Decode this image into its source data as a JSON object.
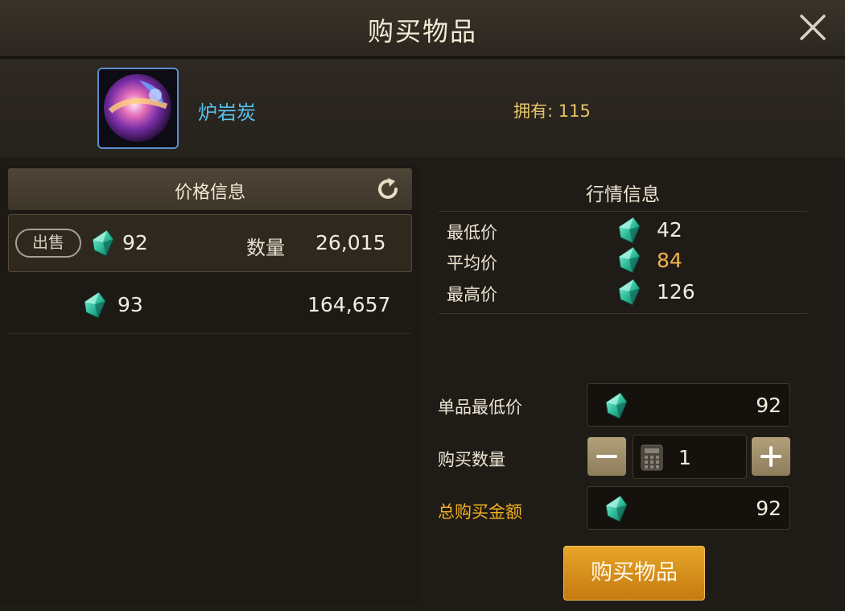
{
  "dialog": {
    "title": "购买物品"
  },
  "item": {
    "name": "炉岩炭",
    "owned_label": "拥有:",
    "owned_count": "115"
  },
  "price_info": {
    "header": "价格信息",
    "rows": [
      {
        "badge": "出售",
        "price": "92",
        "qty_label": "数量",
        "qty": "26,015"
      },
      {
        "price": "93",
        "qty": "164,657"
      }
    ]
  },
  "market": {
    "header": "行情信息",
    "lowest": {
      "label": "最低价",
      "value": "42"
    },
    "average": {
      "label": "平均价",
      "value": "84"
    },
    "highest": {
      "label": "最高价",
      "value": "126"
    }
  },
  "purchase": {
    "unit_min_label": "单品最低价",
    "unit_min_value": "92",
    "qty_label": "购买数量",
    "qty_value": "1",
    "total_label": "总购买金额",
    "total_value": "92",
    "buy_button": "购买物品"
  },
  "colors": {
    "accent_gold": "#e7c46a",
    "item_name_blue": "#57c0ee",
    "average_price": "#f0b545",
    "total_label": "#f0b020",
    "buy_button": "#d98f1b"
  },
  "icons": [
    "close-icon",
    "refresh-icon",
    "gem-icon",
    "calculator-icon",
    "minus-icon",
    "plus-icon"
  ]
}
